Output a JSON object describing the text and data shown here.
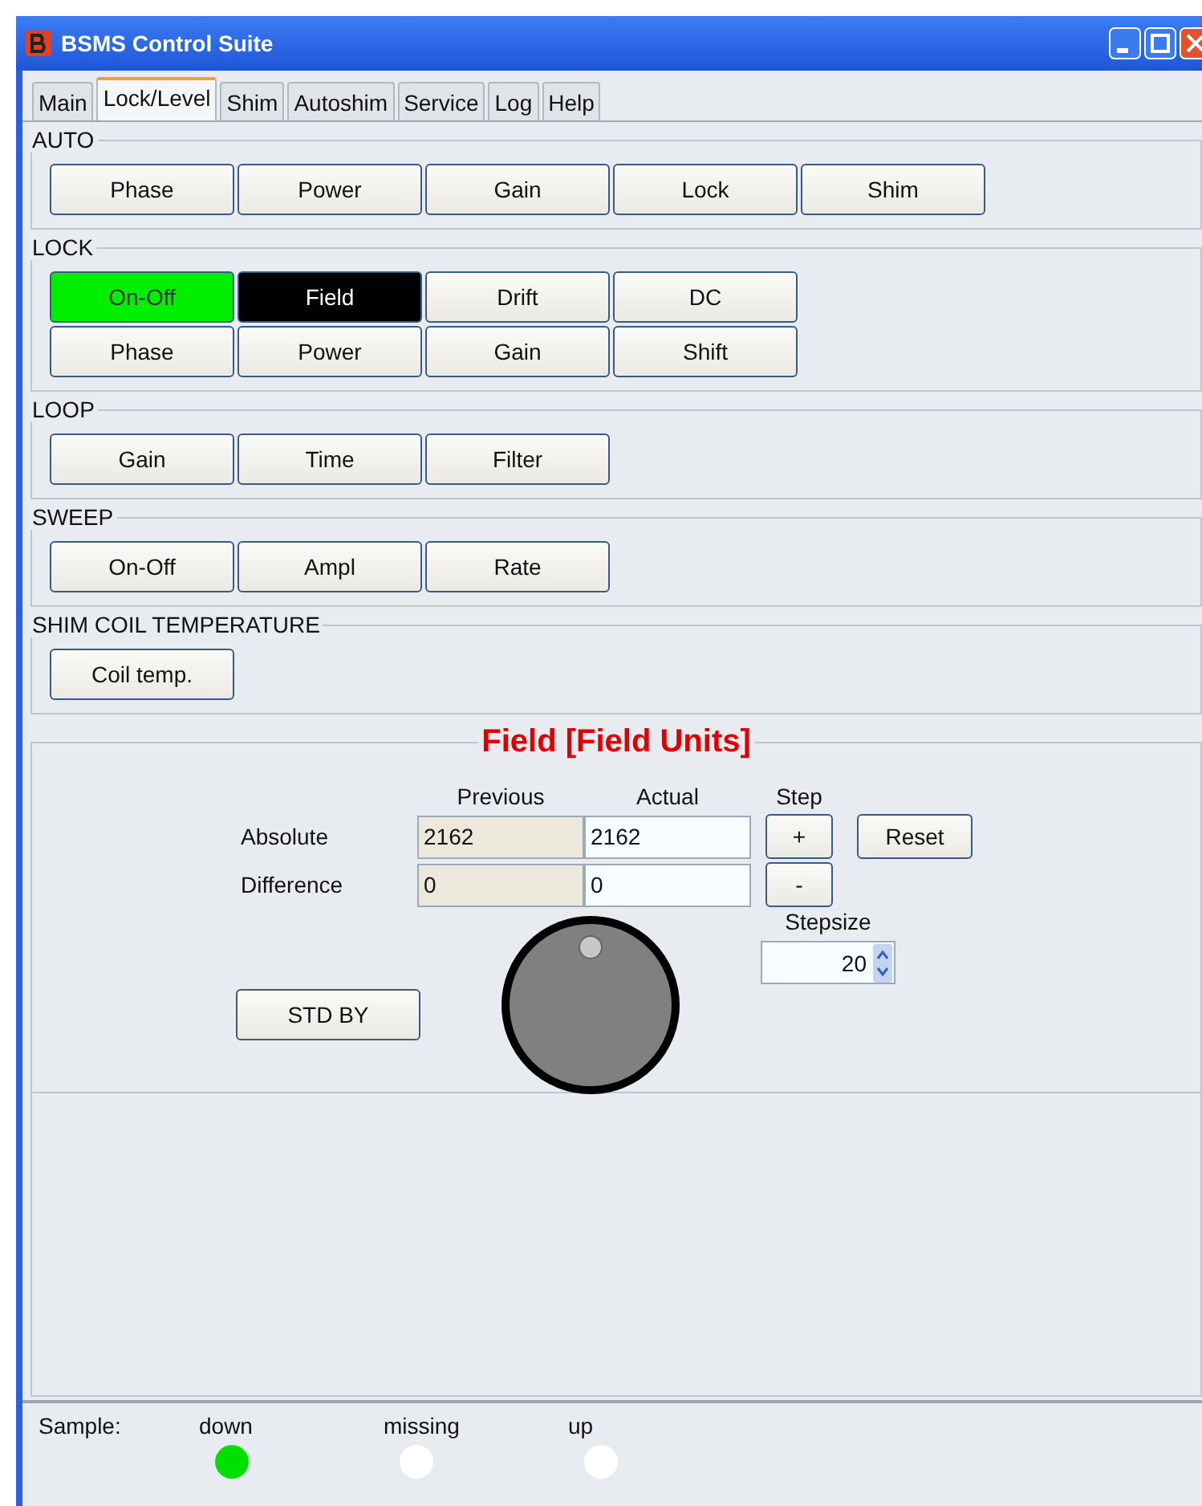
{
  "window": {
    "title": "BSMS Control Suite"
  },
  "tabs": [
    {
      "label": "Main",
      "selected": false
    },
    {
      "label": "Lock/Level",
      "selected": true
    },
    {
      "label": "Shim",
      "selected": false
    },
    {
      "label": "Autoshim",
      "selected": false
    },
    {
      "label": "Service",
      "selected": false
    },
    {
      "label": "Log",
      "selected": false
    },
    {
      "label": "Help",
      "selected": false
    }
  ],
  "sections": [
    {
      "title": "AUTO",
      "rows": [
        [
          {
            "label": "Phase",
            "kind": "plain"
          },
          {
            "label": "Power",
            "kind": "plain"
          },
          {
            "label": "Gain",
            "kind": "plain"
          },
          {
            "label": "Lock",
            "kind": "plain"
          },
          {
            "label": "Shim",
            "kind": "plain"
          }
        ]
      ]
    },
    {
      "title": "LOCK",
      "rows": [
        [
          {
            "label": "On-Off",
            "kind": "lit"
          },
          {
            "label": "Field",
            "kind": "dark"
          },
          {
            "label": "Drift",
            "kind": "plain"
          },
          {
            "label": "DC",
            "kind": "plain"
          }
        ],
        [
          {
            "label": "Phase",
            "kind": "plain"
          },
          {
            "label": "Power",
            "kind": "plain"
          },
          {
            "label": "Gain",
            "kind": "plain"
          },
          {
            "label": "Shift",
            "kind": "plain"
          }
        ]
      ]
    },
    {
      "title": "LOOP",
      "rows": [
        [
          {
            "label": "Gain",
            "kind": "plain"
          },
          {
            "label": "Time",
            "kind": "plain"
          },
          {
            "label": "Filter",
            "kind": "plain"
          }
        ]
      ]
    },
    {
      "title": "SWEEP",
      "rows": [
        [
          {
            "label": "On-Off",
            "kind": "plain"
          },
          {
            "label": "Ampl",
            "kind": "plain"
          },
          {
            "label": "Rate",
            "kind": "plain"
          }
        ]
      ]
    },
    {
      "title": "SHIM COIL TEMPERATURE",
      "rows": [
        [
          {
            "label": "Coil temp.",
            "kind": "plain"
          }
        ]
      ]
    }
  ],
  "field": {
    "title": "Field [Field Units]",
    "col_previous": "Previous",
    "col_actual": "Actual",
    "col_step": "Step",
    "rows": [
      {
        "label": "Absolute",
        "previous": "2162",
        "actual": "2162",
        "step": "+"
      },
      {
        "label": "Difference",
        "previous": "0",
        "actual": "0",
        "step": "-"
      }
    ],
    "reset": "Reset",
    "stepsize_label": "Stepsize",
    "stepsize": "20",
    "standby": "STD BY"
  },
  "sample": {
    "label": "Sample:",
    "states": [
      {
        "label": "down",
        "color": "#00e000"
      },
      {
        "label": "missing",
        "color": "#ffffff"
      },
      {
        "label": "up",
        "color": "#ffffff"
      }
    ]
  }
}
